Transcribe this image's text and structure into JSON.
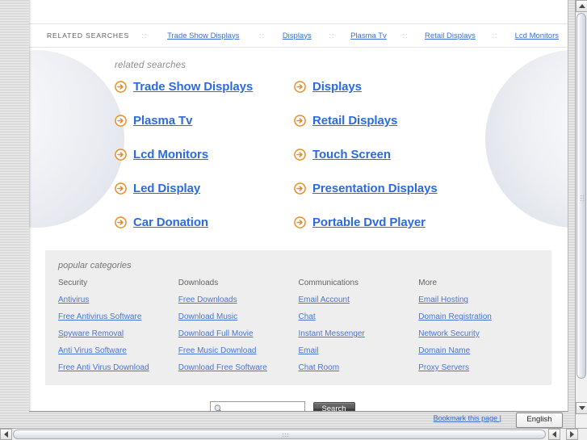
{
  "top_strip": {
    "label": "RELATED SEARCHES",
    "separator": "::",
    "links": [
      "Trade Show Displays",
      "Displays",
      "Plasma Tv",
      "Retail Displays",
      "Lcd Monitors"
    ]
  },
  "related": {
    "heading": "related searches",
    "icon": "circle-arrow-right-icon",
    "items": [
      "Trade Show Displays",
      "Displays",
      "Plasma Tv",
      "Retail Displays",
      "Lcd Monitors",
      "Touch Screen",
      "Led Display",
      "Presentation Displays",
      "Car Donation",
      "Portable Dvd Player"
    ]
  },
  "categories": {
    "heading": "popular categories",
    "columns": [
      {
        "title": "Security",
        "links": [
          "Antivirus",
          "Free Antivirus Software",
          "Spyware Removal",
          "Anti Virus Software",
          "Free Anti Virus Download"
        ]
      },
      {
        "title": "Downloads",
        "links": [
          "Free Downloads",
          "Download Music",
          "Download Full Movie",
          "Free Music Download",
          "Download Free Software"
        ]
      },
      {
        "title": "Communications",
        "links": [
          "Email Account",
          "Chat",
          "Instant Messenger",
          "Email",
          "Chat Room"
        ]
      },
      {
        "title": "More",
        "links": [
          "Email Hosting",
          "Domain Registration",
          "Network Security",
          "Domain Name",
          "Proxy Servers"
        ]
      }
    ]
  },
  "search": {
    "value": "",
    "placeholder": "",
    "button_label": "Search",
    "icon": "magnifier-icon"
  },
  "status_bar": {
    "bookmark_label": "Bookmark this page |",
    "language_value": "English"
  },
  "colors": {
    "link_blue": "#2b6bdd",
    "small_link_blue": "#4774d6",
    "arrow_orange": "#f08a1a",
    "panel_gray": "#eeeeee",
    "heading_gray": "#8d8d8d"
  }
}
